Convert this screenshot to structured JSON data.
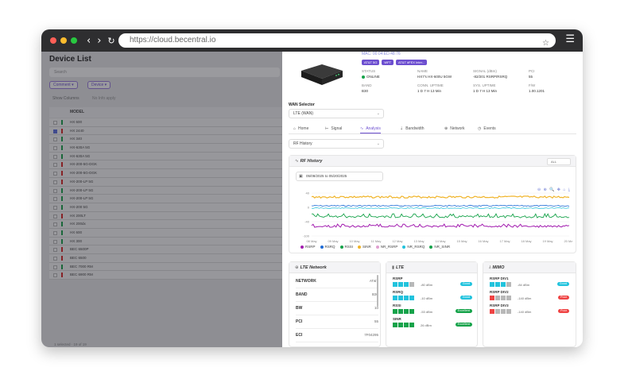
{
  "browser": {
    "url": "https://cloud.becentral.io"
  },
  "left": {
    "title": "Device List",
    "search_placeholder": "Search",
    "filters": [
      "Comment",
      "Device"
    ],
    "sub_links": [
      "Show Columns",
      "No Info apply"
    ],
    "header": "MODEL",
    "rows": [
      {
        "model": "HX 600",
        "color": "#16a34a",
        "checked": false
      },
      {
        "model": "HX 2440",
        "color": "#dc2626",
        "checked": true
      },
      {
        "model": "HX 340",
        "color": "#16a34a",
        "checked": false
      },
      {
        "model": "HX-630A 5G",
        "color": "#16a34a",
        "checked": false
      },
      {
        "model": "HX-630A 5G",
        "color": "#16a34a",
        "checked": false
      },
      {
        "model": "HX-200-5G-DGK",
        "color": "#dc2626",
        "checked": false
      },
      {
        "model": "HX-200-5G-DGK",
        "color": "#dc2626",
        "checked": false
      },
      {
        "model": "HX-200-LP 5G",
        "color": "#dc2626",
        "checked": false
      },
      {
        "model": "HX-200-LP 5G",
        "color": "#16a34a",
        "checked": false
      },
      {
        "model": "HX-200-LP 5G",
        "color": "#16a34a",
        "checked": false
      },
      {
        "model": "HX-200 5G",
        "color": "#16a34a",
        "checked": false
      },
      {
        "model": "HX 200LT",
        "color": "#dc2626",
        "checked": false
      },
      {
        "model": "HX 200dx",
        "color": "#16a34a",
        "checked": false
      },
      {
        "model": "HX 600",
        "color": "#16a34a",
        "checked": false
      },
      {
        "model": "HX 300",
        "color": "#16a34a",
        "checked": false
      },
      {
        "model": "BEC 6500P",
        "color": "#dc2626",
        "checked": false
      },
      {
        "model": "BEC 6500",
        "color": "#dc2626",
        "checked": false
      },
      {
        "model": "BEC 7000 RM",
        "color": "#16a34a",
        "checked": false
      },
      {
        "model": "BEC 6900 RM",
        "color": "#dc2626",
        "checked": false
      }
    ],
    "footer": "1 selected · 19 of 19"
  },
  "device": {
    "mac": "MAC: 00:04:ED:48:76",
    "tags": [
      "AT&T 5G",
      "WFT",
      "AT&T #FEX Inter..."
    ],
    "info": [
      {
        "k": "STATUS",
        "v": "ONLINE"
      },
      {
        "k": "NAME",
        "v": "HX7's HX-600U 5GW"
      },
      {
        "k": "SIGNAL (dBm)",
        "v": "-82/201 RSRP/RSRQ"
      },
      {
        "k": "PCI",
        "v": "55"
      },
      {
        "k": "BAND",
        "v": "B30"
      },
      {
        "k": "CONN. UPTIME",
        "v": "1 D 7 H 13 Min"
      },
      {
        "k": "SYS. UPTIME",
        "v": "1 D 7 H 13 Min"
      },
      {
        "k": "F/W",
        "v": "1.00.1201"
      }
    ]
  },
  "wan": {
    "label": "WAN Selector",
    "value": "LTE (WAN)"
  },
  "tabs": [
    {
      "label": "Home",
      "icon": "⌂"
    },
    {
      "label": "Signal",
      "icon": "⊢"
    },
    {
      "label": "Analysis",
      "icon": "∿"
    },
    {
      "label": "Bandwidth",
      "icon": "⇣"
    },
    {
      "label": "Network",
      "icon": "⊕"
    },
    {
      "label": "Events",
      "icon": "◷"
    }
  ],
  "history_select": "RF History",
  "rf": {
    "title": "RF History",
    "range_select": "ALL",
    "date_range": "05/08/2025 to 05/20/2025",
    "tools": "⊖ ⊕ 🔍 ✥ ⌂ ⤓",
    "colors": {
      "rsrp": "#f0b429",
      "rsrq": "#1e6bd6",
      "rssi": "#16a34a",
      "sinr": "#a21caf",
      "nr_rsrp": "#22c3dd",
      "nr_sinr": "#e0a0d0"
    }
  },
  "chart_data": {
    "type": "line",
    "x": [
      "08 May",
      "09 May",
      "10 May",
      "11 May",
      "12 May",
      "13 May",
      "14 May",
      "15 May",
      "16 May",
      "17 May",
      "18 May",
      "19 May",
      "20 May"
    ],
    "ytick_labels": [
      "40",
      "0",
      "-40",
      "-100"
    ],
    "series": [
      {
        "name": "RSRP"
      },
      {
        "name": "RSRQ"
      },
      {
        "name": "RSSI"
      },
      {
        "name": "SINR"
      },
      {
        "name": "NR_RSRP"
      },
      {
        "name": "NR_RSRQ"
      },
      {
        "name": "NR_SINR"
      }
    ],
    "legend": "bottom"
  },
  "lte_network": {
    "title": "LTE Network",
    "rows": [
      {
        "k": "NETWORK",
        "v": "AT&T"
      },
      {
        "k": "BAND",
        "v": "B30"
      },
      {
        "k": "BW",
        "v": "10"
      },
      {
        "k": "PCI",
        "v": "55"
      },
      {
        "k": "ECI",
        "v": "7F04295"
      }
    ]
  },
  "lte": {
    "title": "LTE",
    "signals": [
      {
        "name": "RSRP",
        "value": "-80 dBm",
        "badge": "Good",
        "color": "#22c3dd",
        "filled": 3,
        "badge_color": "#22c3dd"
      },
      {
        "name": "RSRQ",
        "value": "-10 dBm",
        "badge": "Good",
        "color": "#22c3dd",
        "filled": 4,
        "badge_color": "#22c3dd"
      },
      {
        "name": "RSSI",
        "value": "-53 dBm",
        "badge": "Excellent",
        "color": "#16a34a",
        "filled": 4,
        "badge_color": "#16a34a"
      },
      {
        "name": "SINR",
        "value": "26 dBm",
        "badge": "Excellent",
        "color": "#16a34a",
        "filled": 4,
        "badge_color": "#16a34a"
      }
    ]
  },
  "mimo": {
    "title": "MIMO",
    "signals": [
      {
        "name": "RSRP DIV1",
        "value": "-84 dBm",
        "badge": "Good",
        "color": "#22c3dd",
        "filled": 3,
        "badge_color": "#22c3dd"
      },
      {
        "name": "RSRP DIV2",
        "value": "-140 dBm",
        "badge": "Poor",
        "color": "#ef4444",
        "filled": 1,
        "badge_color": "#ef4444"
      },
      {
        "name": "RSRP DIV3",
        "value": "-140 dBm",
        "badge": "Poor",
        "color": "#ef4444",
        "filled": 1,
        "badge_color": "#ef4444"
      }
    ]
  }
}
